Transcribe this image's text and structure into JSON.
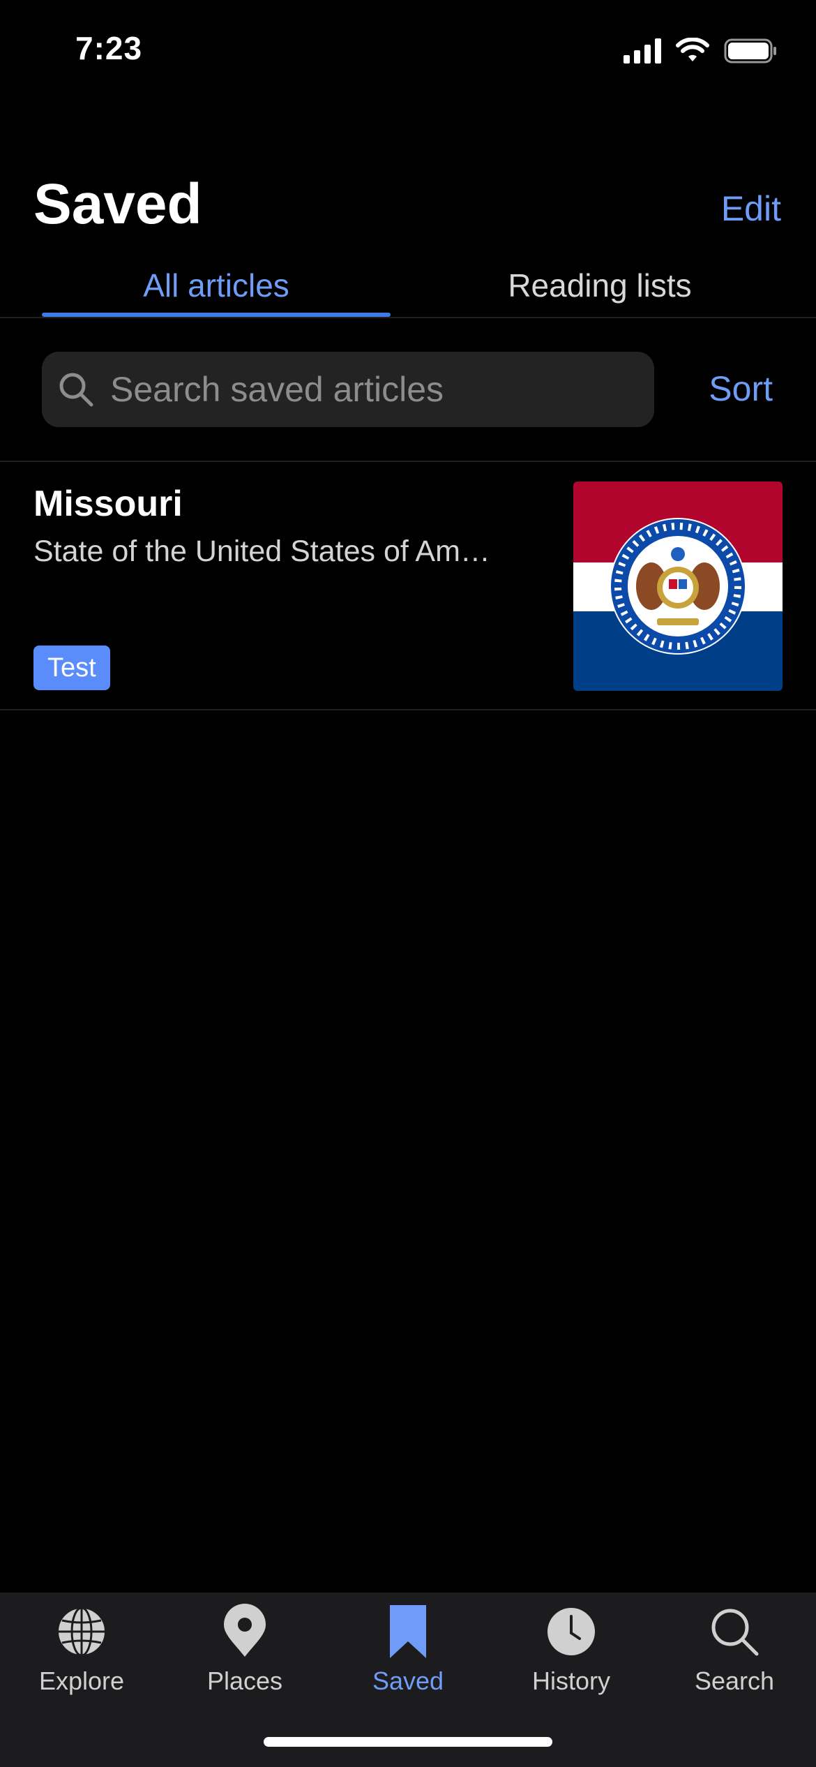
{
  "status_bar": {
    "time": "7:23"
  },
  "header": {
    "title": "Saved",
    "edit_label": "Edit"
  },
  "tabs": [
    {
      "label": "All articles",
      "active": true
    },
    {
      "label": "Reading lists",
      "active": false
    }
  ],
  "search": {
    "placeholder": "Search saved articles",
    "sort_label": "Sort"
  },
  "articles": [
    {
      "title": "Missouri",
      "description": "State of the United States of Am…",
      "tag": "Test",
      "thumbnail": "missouri-flag"
    }
  ],
  "tabbar": {
    "items": [
      {
        "label": "Explore",
        "icon": "globe-icon",
        "active": false
      },
      {
        "label": "Places",
        "icon": "map-pin-icon",
        "active": false
      },
      {
        "label": "Saved",
        "icon": "bookmark-icon",
        "active": true
      },
      {
        "label": "History",
        "icon": "clock-icon",
        "active": false
      },
      {
        "label": "Search",
        "icon": "search-icon",
        "active": false
      }
    ]
  },
  "colors": {
    "accent": "#6e9cf7",
    "tag_background": "#5a8dfb",
    "background": "#000000",
    "tabbar_background": "#1c1c1e"
  }
}
